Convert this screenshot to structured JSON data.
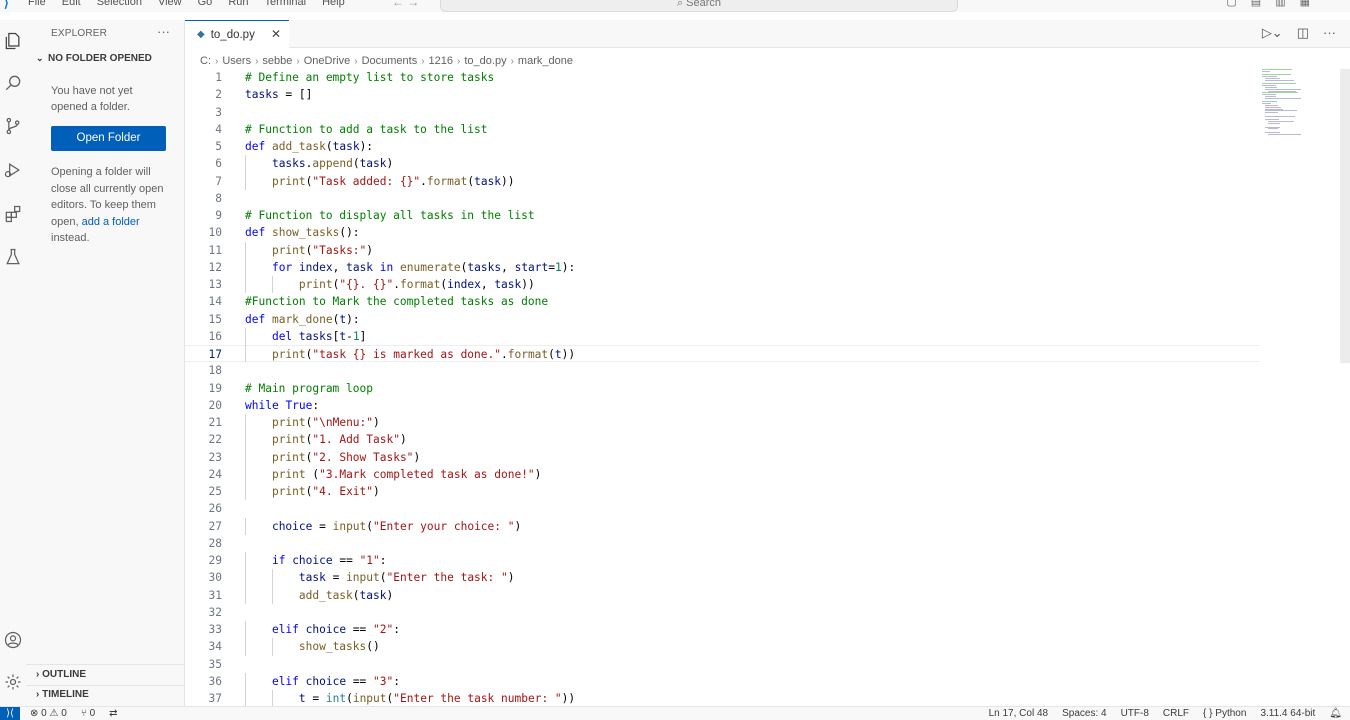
{
  "titlebar": {
    "menu": [
      "File",
      "Edit",
      "Selection",
      "View",
      "Go",
      "Run",
      "Terminal",
      "Help"
    ],
    "search_placeholder": "Search"
  },
  "sidebar": {
    "title": "EXPLORER",
    "section": "NO FOLDER OPENED",
    "message_1": "You have not yet opened a folder.",
    "open_folder_label": "Open Folder",
    "message_2_start": "Opening a folder will close all currently open editors. To keep them open, ",
    "message_2_link": "add a folder",
    "message_2_end": " instead.",
    "outline_label": "OUTLINE",
    "timeline_label": "TIMELINE"
  },
  "tab": {
    "filename": "to_do.py"
  },
  "breadcrumb": [
    "C:",
    "Users",
    "sebbe",
    "OneDrive",
    "Documents",
    "1216",
    "to_do.py",
    "mark_done"
  ],
  "editor": {
    "lines": [
      {
        "n": "1",
        "text": "# Define an empty list to store tasks"
      },
      {
        "n": "2",
        "text": "tasks = []"
      },
      {
        "n": "3",
        "text": ""
      },
      {
        "n": "4",
        "text": "# Function to add a task to the list"
      },
      {
        "n": "5",
        "text": "def add_task(task):"
      },
      {
        "n": "6",
        "text": "    tasks.append(task)"
      },
      {
        "n": "7",
        "text": "    print(\"Task added: {}\".format(task))"
      },
      {
        "n": "8",
        "text": ""
      },
      {
        "n": "9",
        "text": "# Function to display all tasks in the list"
      },
      {
        "n": "10",
        "text": "def show_tasks():"
      },
      {
        "n": "11",
        "text": "    print(\"Tasks:\")"
      },
      {
        "n": "12",
        "text": "    for index, task in enumerate(tasks, start=1):"
      },
      {
        "n": "13",
        "text": "        print(\"{}. {}\".format(index, task))"
      },
      {
        "n": "14",
        "text": "#Function to Mark the completed tasks as done"
      },
      {
        "n": "15",
        "text": "def mark_done(t):"
      },
      {
        "n": "16",
        "text": "    del tasks[t-1]"
      },
      {
        "n": "17",
        "text": "    print(\"task {} is marked as done.\".format(t))"
      },
      {
        "n": "18",
        "text": ""
      },
      {
        "n": "19",
        "text": "# Main program loop"
      },
      {
        "n": "20",
        "text": "while True:"
      },
      {
        "n": "21",
        "text": "    print(\"\\nMenu:\")"
      },
      {
        "n": "22",
        "text": "    print(\"1. Add Task\")"
      },
      {
        "n": "23",
        "text": "    print(\"2. Show Tasks\")"
      },
      {
        "n": "24",
        "text": "    print (\"3.Mark completed task as done!\")"
      },
      {
        "n": "25",
        "text": "    print(\"4. Exit\")"
      },
      {
        "n": "26",
        "text": ""
      },
      {
        "n": "27",
        "text": "    choice = input(\"Enter your choice: \")"
      },
      {
        "n": "28",
        "text": ""
      },
      {
        "n": "29",
        "text": "    if choice == \"1\":"
      },
      {
        "n": "30",
        "text": "        task = input(\"Enter the task: \")"
      },
      {
        "n": "31",
        "text": "        add_task(task)"
      },
      {
        "n": "32",
        "text": ""
      },
      {
        "n": "33",
        "text": "    elif choice == \"2\":"
      },
      {
        "n": "34",
        "text": "        show_tasks()"
      },
      {
        "n": "35",
        "text": ""
      },
      {
        "n": "36",
        "text": "    elif choice == \"3\":"
      },
      {
        "n": "37",
        "text": "        t = int(input(\"Enter the task number: \"))"
      }
    ],
    "current_line": 17
  },
  "statusbar": {
    "errors": "0",
    "warnings": "0",
    "ports": "0",
    "position": "Ln 17, Col 48",
    "spaces": "Spaces: 4",
    "encoding": "UTF-8",
    "eol": "CRLF",
    "language": "Python",
    "interpreter": "3.11.4 64-bit"
  },
  "colors": {
    "accent": "#005fb8",
    "keyword": "#0000ff",
    "comment": "#008000",
    "string": "#a31515",
    "function": "#795e26",
    "variable": "#001080",
    "builtin_type": "#267f99"
  }
}
